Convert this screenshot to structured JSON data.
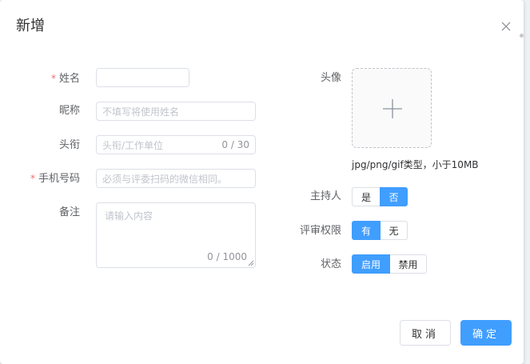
{
  "dialog": {
    "title": "新增",
    "close_icon": "close-icon"
  },
  "form": {
    "name": {
      "required_mark": "*",
      "label": "姓名",
      "value": ""
    },
    "nickname": {
      "label": "昵称",
      "placeholder": "不填写将使用姓名"
    },
    "title_field": {
      "label": "头衔",
      "placeholder": "头衔/工作单位",
      "count": "0 / 30"
    },
    "phone": {
      "required_mark": "*",
      "label": "手机号码",
      "placeholder": "必须与评委扫码的微信相同。"
    },
    "remark": {
      "label": "备注",
      "placeholder": "请输入内容",
      "count": "0 / 1000"
    }
  },
  "avatar": {
    "label": "头像",
    "upload_icon": "plus-icon",
    "hint": "jpg/png/gif类型，小于10MB"
  },
  "host": {
    "label": "主持人",
    "options": [
      "是",
      "否"
    ],
    "selected": "否"
  },
  "review": {
    "label": "评审权限",
    "options": [
      "有",
      "无"
    ],
    "selected": "有"
  },
  "status": {
    "label": "状态",
    "options": [
      "启用",
      "禁用"
    ],
    "selected": "启用"
  },
  "footer": {
    "cancel_label": "取消",
    "ok_label": "确定"
  },
  "colors": {
    "primary": "#409eff",
    "required": "#f56c6c",
    "border": "#dcdfe6"
  }
}
